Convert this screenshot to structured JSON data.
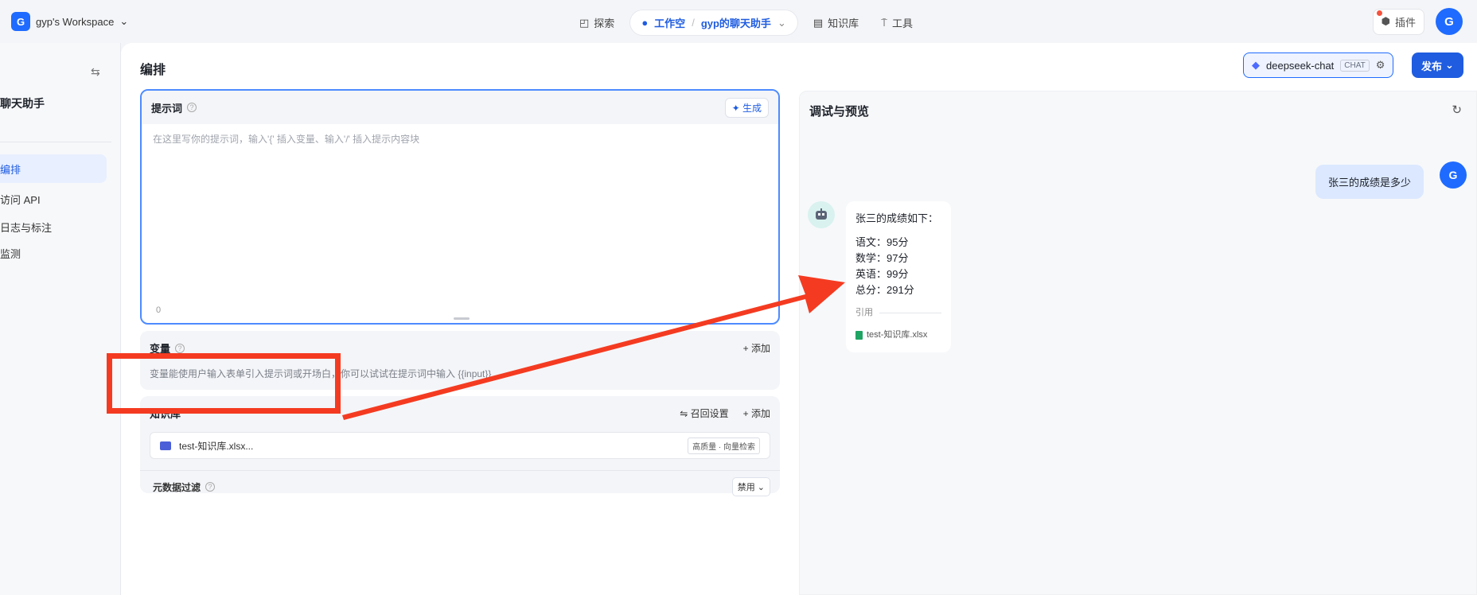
{
  "topbar": {
    "workspace_logo": "G",
    "workspace_name": "gyp's Workspace",
    "nav": {
      "explore": "探索",
      "workspace": "工作空",
      "bot_name": "gyp的聊天助手",
      "knowledge": "知识库",
      "tools": "工具"
    },
    "plugin": "插件",
    "avatar": "G"
  },
  "sidebar": {
    "bot_name": "聊天助手",
    "items": [
      {
        "label": "编排",
        "active": true
      },
      {
        "label": "访问 API",
        "active": false
      },
      {
        "label": "日志与标注",
        "active": false
      },
      {
        "label": "监测",
        "active": false
      }
    ]
  },
  "main": {
    "title": "编排",
    "model": "deepseek-chat",
    "model_tag": "CHAT",
    "publish": "发布",
    "prompt": {
      "label": "提示词",
      "generate": "生成",
      "placeholder": "在这里写你的提示词，输入'{' 插入变量、输入'/' 插入提示内容块",
      "counter": "0"
    },
    "variables": {
      "label": "变量",
      "add": "+ 添加",
      "desc": "变量能使用户输入表单引入提示词或开场白，你可以试试在提示词中输入 {{input}}"
    },
    "knowledge": {
      "label": "知识库",
      "recall": "召回设置",
      "add": "+ 添加",
      "file_name": "test-知识库.xlsx...",
      "file_tag": "高质量 · 向量检索"
    },
    "metadata": {
      "label": "元数据过滤",
      "value": "禁用"
    }
  },
  "preview": {
    "title": "调试与预览",
    "user_message": "张三的成绩是多少",
    "user_avatar": "G",
    "bot_intro": "张三的成绩如下：",
    "bot_lines": [
      "语文：95分",
      "数学：97分",
      "英语：99分",
      "总分：291分"
    ],
    "cite_label": "引用",
    "cite_file": "test-知识库.xlsx"
  },
  "colors": {
    "accent": "#1f5ce0",
    "annotation": "#f43b21"
  }
}
